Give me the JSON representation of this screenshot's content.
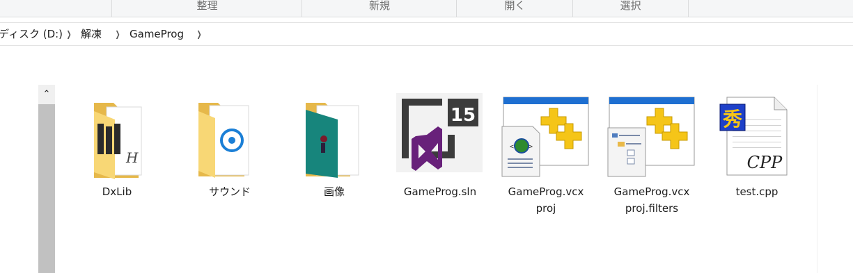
{
  "ribbon": {
    "groups": [
      "整理",
      "新規",
      "開く",
      "選択"
    ]
  },
  "breadcrumb": {
    "items": [
      "ディスク (D:)",
      "解凍",
      "GameProg"
    ]
  },
  "files": [
    {
      "name": "DxLib",
      "type": "folder"
    },
    {
      "name": "サウンド",
      "type": "folder"
    },
    {
      "name": "画像",
      "type": "folder"
    },
    {
      "name": "GameProg.sln",
      "type": "visual-studio-solution"
    },
    {
      "name_line1": "GameProg.vcx",
      "name_line2": "proj",
      "type": "vcxproj"
    },
    {
      "name_line1": "GameProg.vcx",
      "name_line2": "proj.filters",
      "type": "vcxproj-filters"
    },
    {
      "name": "test.cpp",
      "type": "cpp-source"
    }
  ],
  "icons": {
    "vs_badge_number": "15",
    "cpp_label": "CPP",
    "cpp_glyph": "秀",
    "dxlib_letter": "H"
  },
  "colors": {
    "folder_yellow": "#f8d775",
    "folder_dark": "#e6b84a",
    "vs_purple": "#68217a",
    "vs_gray": "#3c3c3c",
    "plus_yellow": "#f5c518",
    "globe_green": "#2e8b2e"
  }
}
